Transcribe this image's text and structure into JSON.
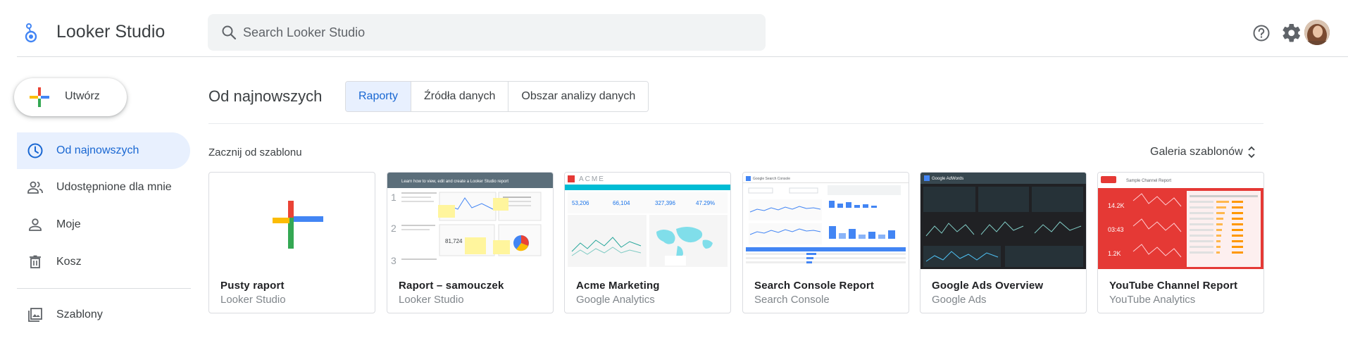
{
  "app": {
    "title": "Looker Studio"
  },
  "search": {
    "placeholder": "Search Looker Studio",
    "value": ""
  },
  "header": {
    "icons": [
      "help-icon",
      "settings-icon"
    ]
  },
  "sidebar": {
    "create_label": "Utwórz",
    "items": [
      {
        "label": "Od najnowszych",
        "icon": "clock-icon",
        "active": true
      },
      {
        "label": "Udostępnione dla mnie",
        "icon": "people-icon",
        "active": false
      },
      {
        "label": "Moje",
        "icon": "person-icon",
        "active": false
      },
      {
        "label": "Kosz",
        "icon": "trash-icon",
        "active": false
      },
      {
        "label": "Szablony",
        "icon": "templates-icon",
        "active": false
      }
    ]
  },
  "main": {
    "title": "Od najnowszych",
    "tabs": [
      {
        "label": "Raporty",
        "active": true
      },
      {
        "label": "Źródła danych",
        "active": false
      },
      {
        "label": "Obszar analizy danych",
        "active": false
      }
    ],
    "templates_heading": "Zacznij od szablonu",
    "gallery_label": "Galeria szablonów"
  },
  "templates": [
    {
      "title": "Pusty raport",
      "subtitle": "Looker Studio"
    },
    {
      "title": "Raport – samouczek",
      "subtitle": "Looker Studio",
      "thumb_text": "Learn how to view, edit and create a Looker Studio report"
    },
    {
      "title": "Acme Marketing",
      "subtitle": "Google Analytics",
      "thumb_brand": "ACME",
      "thumb_stats": [
        "53,206",
        "66,104",
        "327,396",
        "47.29%"
      ]
    },
    {
      "title": "Search Console Report",
      "subtitle": "Search Console",
      "thumb_brand": "Google Search Console"
    },
    {
      "title": "Google Ads Overview",
      "subtitle": "Google Ads",
      "thumb_brand": "Google AdWords"
    },
    {
      "title": "YouTube Channel Report",
      "subtitle": "YouTube Analytics",
      "thumb_brand": "Sample Channel Report",
      "thumb_stats": [
        "14.2K",
        "03:43",
        "1.2K"
      ]
    }
  ],
  "colors": {
    "accent": "#1967d2",
    "active_bg": "#e8f0fe",
    "plus_red": "#ea4335",
    "plus_yellow": "#fbbc04",
    "plus_green": "#34a853",
    "plus_blue": "#4285f4"
  }
}
